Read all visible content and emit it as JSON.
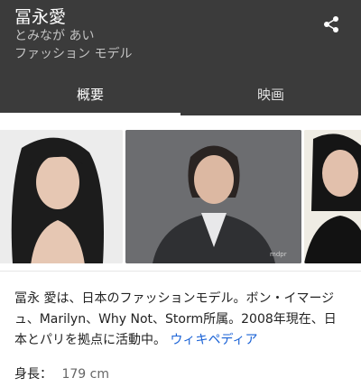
{
  "entity": {
    "name": "冨永愛",
    "reading": "とみなが あい",
    "description": "ファッション モデル"
  },
  "tabs": [
    {
      "label": "概要",
      "active": true
    },
    {
      "label": "映画",
      "active": false
    }
  ],
  "summary": {
    "text": "冨永 愛は、日本のファッションモデル。ボン・イマージュ、Marilyn、Why Not、Storm所属。2008年現在、日本とパリを拠点に活動中。",
    "source_link": "ウィキペディア"
  },
  "facts": [
    {
      "label": "身長：",
      "value": "179 cm"
    }
  ],
  "icons": {
    "share": "share-icon"
  },
  "colors": {
    "header_bg": "#3b3b3b",
    "link": "#1a62d6"
  }
}
